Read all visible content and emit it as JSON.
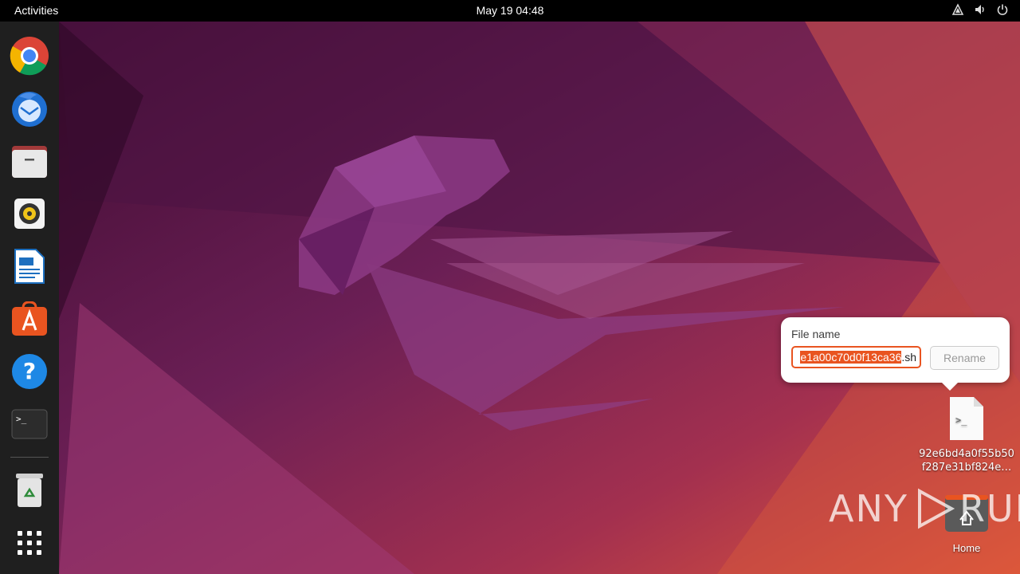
{
  "topbar": {
    "activities_label": "Activities",
    "clock": "May 19  04:48",
    "tray_icons": [
      "network-icon",
      "volume-icon",
      "power-icon"
    ]
  },
  "dock": {
    "items": [
      {
        "name": "chrome-icon"
      },
      {
        "name": "thunderbird-icon"
      },
      {
        "name": "files-icon"
      },
      {
        "name": "rhythmbox-icon"
      },
      {
        "name": "writer-icon"
      },
      {
        "name": "app-center-icon"
      },
      {
        "name": "help-icon"
      },
      {
        "name": "terminal-icon"
      },
      {
        "name": "trash-icon"
      },
      {
        "name": "show-apps-icon"
      }
    ]
  },
  "popover": {
    "title": "File name",
    "field_selected": "e1a00c70d0f13ca36",
    "field_ext": ".sh",
    "rename_label": "Rename"
  },
  "desktop": {
    "script_file_line1": "92e6bd4a0f55b50",
    "script_file_line2": "f287e31bf824e…",
    "home_label": "Home"
  },
  "watermark": {
    "text_left": "ANY",
    "text_right": "RUN"
  },
  "colors": {
    "accent": "#e95420",
    "topbar": "#000000",
    "dock": "#1f1f1f"
  }
}
